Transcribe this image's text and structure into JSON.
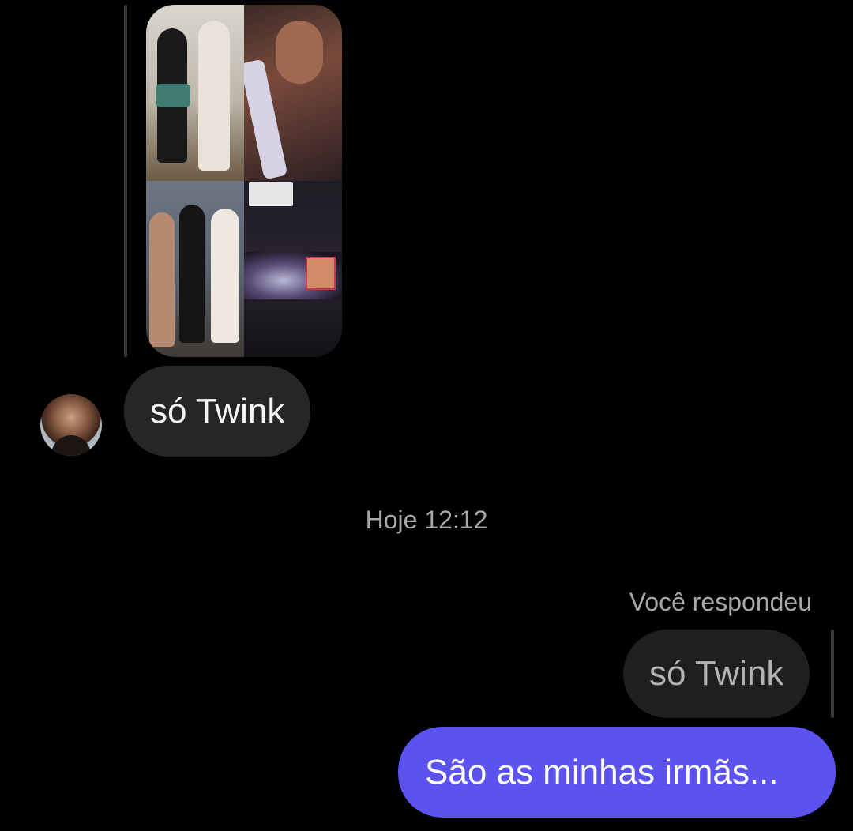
{
  "thread": {
    "received_message": "só Twink",
    "timestamp": "Hoje 12:12",
    "reply_label": "Você respondeu",
    "quoted_message": "só Twink",
    "sent_message": "São as minhas irmãs..."
  },
  "colors": {
    "background": "#000000",
    "received_bubble": "#262626",
    "quoted_bubble": "#1f1f1f",
    "sent_bubble": "#5b52f0",
    "secondary_text": "#a8a8a8"
  },
  "icons": {
    "avatar": "contact-avatar"
  }
}
